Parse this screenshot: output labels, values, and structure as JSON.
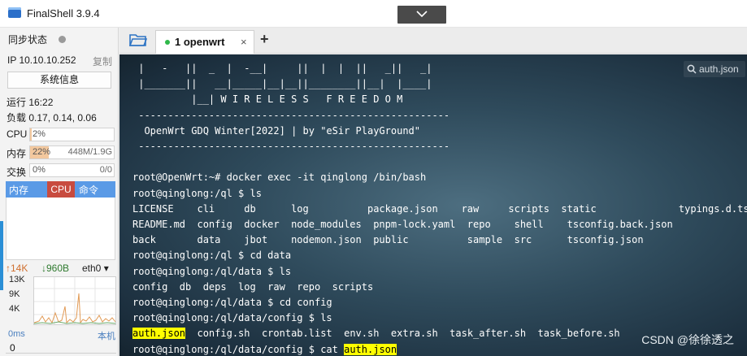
{
  "window": {
    "title": "FinalShell 3.9.4"
  },
  "sidebar": {
    "sync_label": "同步状态",
    "ip": "IP 10.10.10.252",
    "copy_label": "复制",
    "sysinfo_button": "系统信息",
    "uptime": "运行 16:22",
    "load": "负载 0.17, 0.14, 0.06",
    "metrics": [
      {
        "label": "CPU",
        "value": "2%",
        "extra": "",
        "fill": 0.02
      },
      {
        "label": "内存",
        "value": "22%",
        "extra": "448M/1.9G",
        "fill": 0.22
      },
      {
        "label": "交换",
        "value": "0%",
        "extra": "0/0",
        "fill": 0.0
      }
    ],
    "process_header": {
      "memory": "内存",
      "cpu": "CPU",
      "command": "命令"
    },
    "network": {
      "upload": "↑14K",
      "download": "↓960B",
      "interface": "eth0",
      "y_labels": [
        "13K",
        "9K",
        "4K"
      ]
    },
    "latency": {
      "label": "0ms",
      "host": "本机",
      "value": "0"
    }
  },
  "tabbar": {
    "tab_label": "1 openwrt",
    "close_glyph": "×",
    "add_glyph": "+"
  },
  "terminal": {
    "search_text": "auth.json",
    "lines": [
      " |   -   ||  _  |  -__|     ||  |  |  ||   _||   _|",
      " |_______||   __|_____|__|__||________||__|  |____|",
      "          |__| W I R E L E S S   F R E E D O M",
      " -----------------------------------------------------",
      "  OpenWrt GDQ Winter[2022] | by \"eSir PlayGround\"",
      " -----------------------------------------------------",
      "",
      "root@OpenWrt:~# docker exec -it qinglong /bin/bash",
      "root@qinglong:/ql $ ls",
      "LICENSE    cli     db      log          package.json    raw     scripts  static              typings.d.ts",
      "README.md  config  docker  node_modules  pnpm-lock.yaml  repo    shell    tsconfig.back.json",
      "back       data    jbot    nodemon.json  public          sample  src      tsconfig.json",
      "root@qinglong:/ql $ cd data",
      "root@qinglong:/ql/data $ ls",
      "config  db  deps  log  raw  repo  scripts",
      "root@qinglong:/ql/data $ cd config",
      "root@qinglong:/ql/data/config $ ls"
    ],
    "line_ls_files": {
      "highlight": "auth.json",
      "rest": "  config.sh  crontab.list  env.sh  extra.sh  task_after.sh  task_before.sh"
    },
    "line_cat": {
      "prefix": "root@qinglong:/ql/data/config $ cat ",
      "highlight": "auth.json"
    },
    "watermark": "CSDN @徐徐透之"
  }
}
